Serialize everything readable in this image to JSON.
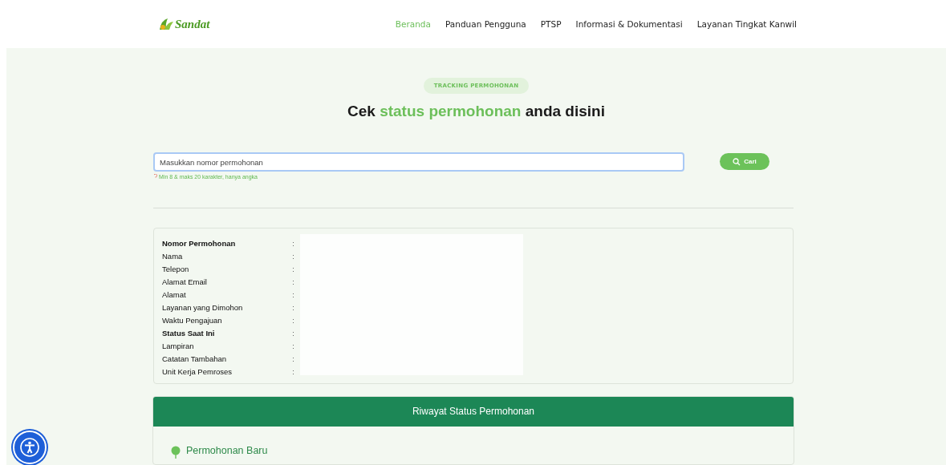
{
  "header": {
    "logo": "Sandat",
    "nav": [
      {
        "label": "Beranda",
        "selected": true
      },
      {
        "label": "Panduan Pengguna",
        "selected": false
      },
      {
        "label": "PTSP",
        "selected": false
      },
      {
        "label": "Informasi & Dokumentasi",
        "selected": false
      },
      {
        "label": "Layanan Tingkat Kanwil",
        "selected": false
      }
    ]
  },
  "hero": {
    "badge": "TRACKING PERMOHONAN",
    "title": "Cek **status permohonan** anda disini"
  },
  "search": {
    "placeholder": "Masukkan nomor permohonan",
    "hint": "Min 8 & maks 20 karakter, hanya angka",
    "button": "Cari"
  },
  "details": {
    "separator": ":",
    "fields": [
      {
        "label": "Nomor Permohonan",
        "bold": true
      },
      {
        "label": "Nama",
        "bold": false
      },
      {
        "label": "Telepon",
        "bold": false
      },
      {
        "label": "Alamat Email",
        "bold": false
      },
      {
        "label": "Alamat",
        "bold": false
      },
      {
        "label": "Layanan yang Dimohon",
        "bold": false
      },
      {
        "label": "Waktu Pengajuan",
        "bold": false
      },
      {
        "label": "Status Saat Ini",
        "bold": true
      },
      {
        "label": "Lampiran",
        "bold": false
      },
      {
        "label": "Catatan Tambahan",
        "bold": false
      },
      {
        "label": "Unit Kerja Pemroses",
        "bold": false
      }
    ]
  },
  "history": {
    "title": "Riwayat Status Permohonan",
    "items": [
      "Permohonan Baru"
    ]
  }
}
